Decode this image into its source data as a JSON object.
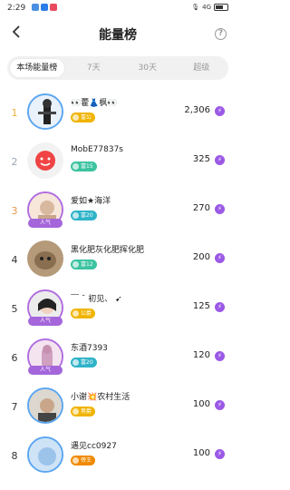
{
  "status_bar": {
    "time": "2:29",
    "app_icons": [
      "#4a90e2",
      "#2b7de9",
      "#e94a5f"
    ],
    "signal_text": "4G"
  },
  "header": {
    "back_icon": "chevron-left-icon",
    "title": "能量榜",
    "help_icon": "?"
  },
  "tabs": [
    {
      "label": "本场能量榜",
      "active": true
    },
    {
      "label": "7天",
      "active": false
    },
    {
      "label": "30天",
      "active": false
    },
    {
      "label": "超级",
      "active": false
    }
  ],
  "entries": [
    {
      "rank": "1",
      "rank_color": "#f2b134",
      "name": "👀藿👗枫👀",
      "badge": "富公",
      "badge_color": "#f0b400",
      "score": "2,306"
    },
    {
      "rank": "2",
      "rank_color": "#9aa5b1",
      "name": "MobE77837s",
      "badge": "富15",
      "badge_color": "#3cc3a0",
      "score": "325"
    },
    {
      "rank": "3",
      "rank_color": "#e29a4a",
      "name": "爱如★海洋",
      "badge": "富20",
      "badge_color": "#2fb3c8",
      "score": "270",
      "frame_label": "人气"
    },
    {
      "rank": "4",
      "rank_color": "#333333",
      "name": "黑化肥灰化肥挥化肥",
      "badge": "富12",
      "badge_color": "#3cc3a0",
      "score": "200"
    },
    {
      "rank": "5",
      "rank_color": "#333333",
      "name": "﹋ ˘ 初见、 ➹",
      "badge": "公爵",
      "badge_color": "#f0b400",
      "score": "125",
      "frame_label": "人气"
    },
    {
      "rank": "6",
      "rank_color": "#333333",
      "name": "东酒7393",
      "badge": "富20",
      "badge_color": "#2fb3c8",
      "score": "120",
      "frame_label": "人气"
    },
    {
      "rank": "7",
      "rank_color": "#333333",
      "name": "小谢💥农村生活",
      "badge": "男爵",
      "badge_color": "#f0b400",
      "score": "100"
    },
    {
      "rank": "8",
      "rank_color": "#333333",
      "name": "遇见cc0927",
      "badge": "帝王",
      "badge_color": "#f08a00",
      "score": "100"
    }
  ]
}
